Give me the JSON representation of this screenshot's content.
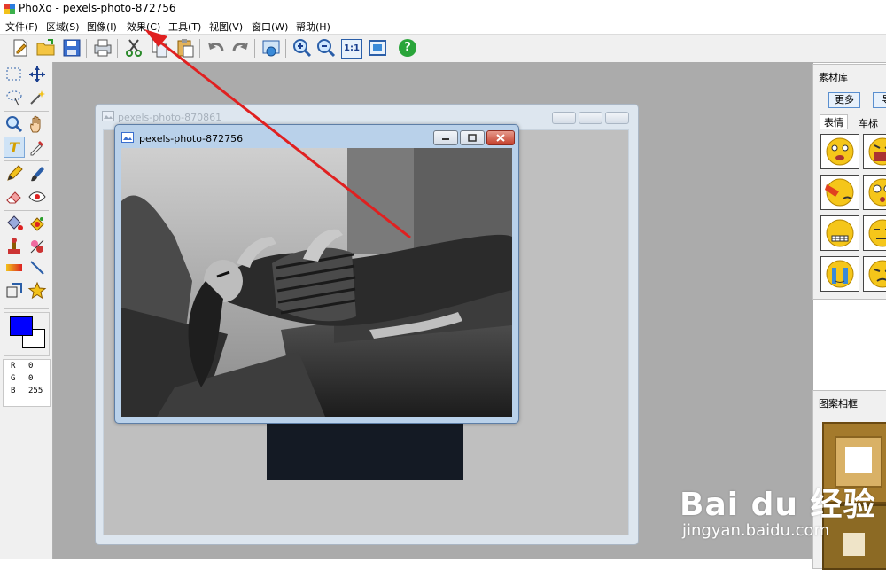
{
  "window": {
    "title": "PhoXo - pexels-photo-872756"
  },
  "menu": [
    {
      "label": "文件(F)"
    },
    {
      "label": "区域(S)"
    },
    {
      "label": "图像(I)"
    },
    {
      "label": "效果(C)"
    },
    {
      "label": "工具(T)"
    },
    {
      "label": "视图(V)"
    },
    {
      "label": "窗口(W)"
    },
    {
      "label": "帮助(H)"
    }
  ],
  "toolbar": [
    {
      "icon": "new-file-icon"
    },
    {
      "icon": "open-folder-icon"
    },
    {
      "icon": "save-icon"
    },
    {
      "icon": "print-icon"
    },
    {
      "icon": "cut-icon"
    },
    {
      "icon": "copy-icon"
    },
    {
      "icon": "paste-icon"
    },
    {
      "icon": "undo-icon"
    },
    {
      "icon": "redo-icon"
    },
    {
      "icon": "capture-icon"
    },
    {
      "icon": "zoom-in-icon"
    },
    {
      "icon": "zoom-out-icon"
    },
    {
      "icon": "actual-size-icon",
      "label": "1:1"
    },
    {
      "icon": "fit-window-icon"
    },
    {
      "icon": "help-icon",
      "label": "?"
    }
  ],
  "colors": {
    "foreground": "#0000ff",
    "background": "#ffffff",
    "accent": "#e02020"
  },
  "rgb": {
    "r_label": "R",
    "r": "0",
    "g_label": "G",
    "g": "0",
    "b_label": "B",
    "b": "255"
  },
  "doc_back": {
    "title": "pexels-photo-870861"
  },
  "doc_front": {
    "title": "pexels-photo-872756"
  },
  "materials": {
    "title": "素材库",
    "more_button": "更多",
    "second_button": "导",
    "tabs": [
      "表情",
      "车标"
    ]
  },
  "frames": {
    "title": "图案相框"
  },
  "watermark": {
    "logo": "Bai du 经验",
    "url": "jingyan.baidu.com"
  }
}
